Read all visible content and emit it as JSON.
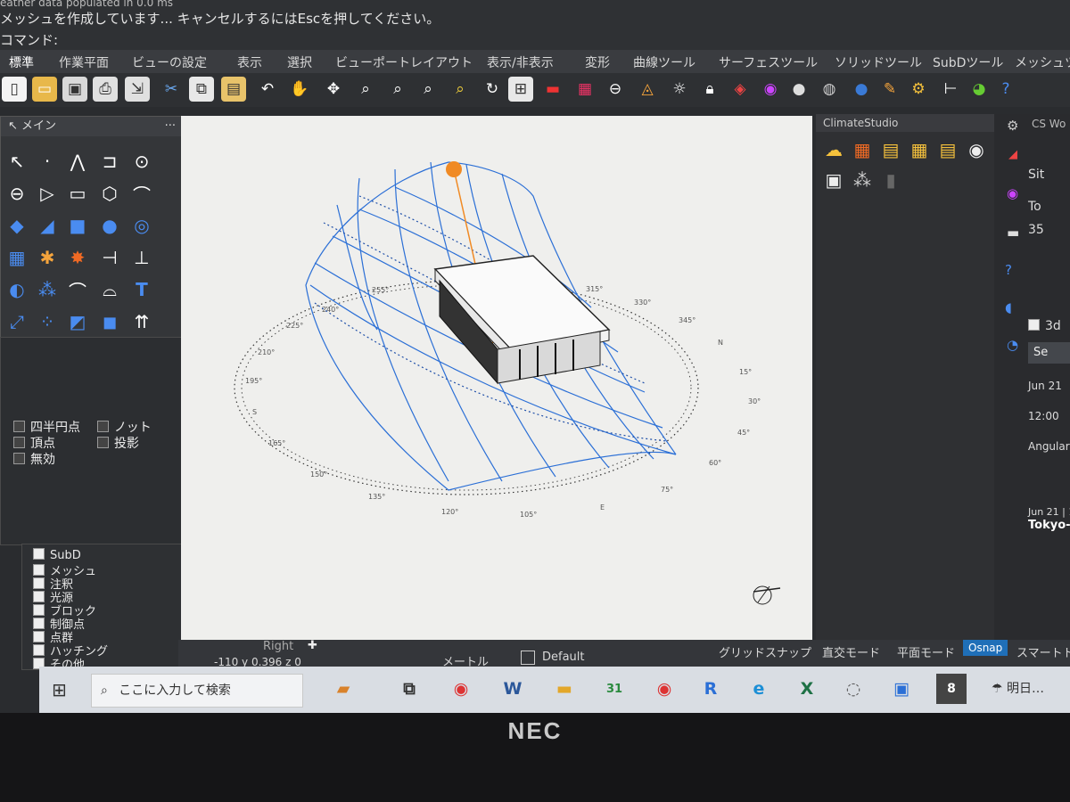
{
  "command_area": {
    "line1": "eather data populated in 0.0 ms",
    "line2": "メッシュを作成しています... キャンセルするにはEscを押してください。",
    "prompt": "コマンド:"
  },
  "menu": {
    "items": [
      "標準",
      "作業平面",
      "ビューの設定",
      "表示",
      "選択",
      "ビューポートレイアウト",
      "表示/非表示",
      "変形",
      "曲線ツール",
      "サーフェスツール",
      "ソリッドツール",
      "SubDツール",
      "メッシュツ"
    ]
  },
  "toolbar": {
    "icons": [
      "new-icon",
      "open-icon",
      "save-icon",
      "print-icon",
      "import-icon",
      "cut-icon",
      "copy-icon",
      "paste-icon",
      "undo-icon",
      "pan-icon",
      "rotate-view-icon",
      "zoom-icon",
      "zoom-window-icon",
      "zoom-extents-icon",
      "zoom-selected-icon",
      "rotate-icon",
      "viewport-layout-icon",
      "car-icon",
      "grid-icon",
      "cplane-icon",
      "osnap-icon",
      "light-icon",
      "lock-icon",
      "layer-icon",
      "color-wheel-icon",
      "material-icon",
      "render-icon",
      "sphere-icon",
      "pencil-icon",
      "gear-icon",
      "tree-icon",
      "globe-icon",
      "help-icon"
    ]
  },
  "main_panel": {
    "title": "メイン",
    "icons": [
      "select-arrow-icon",
      "point-icon",
      "polyline-icon",
      "curve-icon",
      "circle-icon",
      "ellipse-icon",
      "polygon-icon",
      "rectangle-icon",
      "hexagon-icon",
      "arc-icon",
      "surface-icon",
      "extrude-icon",
      "box-icon",
      "sphere-solid-icon",
      "cylinder-icon",
      "mesh-icon",
      "explode-icon",
      "burst-icon",
      "split-icon",
      "trim-icon",
      "boolean-icon",
      "join-icon",
      "fillet-icon",
      "blend-icon",
      "text-icon",
      "scale-icon",
      "array-icon",
      "transform-icon",
      "cube-icon",
      "grip-icon",
      "grid-array-icon",
      "gumball-icon",
      "move-icon",
      "drag-icon",
      "check-icon",
      "group-icon",
      "dim-icon"
    ]
  },
  "osnap": {
    "items": [
      {
        "label": "四半円点"
      },
      {
        "label": "ノット"
      },
      {
        "label": "頂点"
      },
      {
        "label": "投影"
      },
      {
        "label": "無効"
      }
    ]
  },
  "layers": {
    "items": [
      "SubD",
      "メッシュ",
      "注釈",
      "光源",
      "ブロック",
      "制御点",
      "点群",
      "ハッチング",
      "その他"
    ]
  },
  "viewport": {
    "angle_labels": [
      "255°",
      "240°",
      "225°",
      "210°",
      "195°",
      "S",
      "165°",
      "150°",
      "135°",
      "120°",
      "105°",
      "E",
      "75°",
      "60°",
      "45°",
      "30°",
      "15°",
      "N",
      "345°",
      "330°",
      "315°"
    ]
  },
  "climate_panel": {
    "title": "ClimateStudio",
    "icons": [
      "weather-icon",
      "sun-analysis-icon",
      "daylight-icon",
      "glare-icon",
      "thermal-icon",
      "view-icon",
      "settings-panel-icon",
      "cluster-icon",
      "building-icon"
    ]
  },
  "cs_panel": {
    "tab": "CS Wo",
    "site": "Sit",
    "city": "To",
    "lat": "35",
    "checkbox_label": "3d",
    "button": "Se",
    "date": "Jun 21",
    "time": "12:00",
    "mode": "Angular",
    "footer1": "Jun 21 | 1",
    "footer2": "Tokyo-C"
  },
  "status": {
    "viewport_tab": "Right",
    "coords": "-110  y 0.396  z 0",
    "units": "メートル",
    "layer": "Default",
    "grid_snap": "グリッドスナップ",
    "ortho": "直交モード",
    "planar": "平面モード",
    "osnap": "Osnap",
    "smarttrack": "スマートトラ"
  },
  "taskbar": {
    "search_placeholder": "ここに入力して検索",
    "weather": "明日…",
    "apps": [
      "briefcase-icon",
      "task-view-icon",
      "chrome-icon",
      "word-icon",
      "explorer-icon",
      "calendar-icon",
      "chrome-alt-icon",
      "rhino-r-icon",
      "edge-icon",
      "excel-icon",
      "cortana-icon",
      "store-icon",
      "rhino-8-icon"
    ]
  },
  "bezel": {
    "brand": "NEC"
  },
  "colors": {
    "accent_blue": "#2b6fd6",
    "sun_orange": "#f08a24",
    "osnap_blue": "#1f6fb8"
  }
}
